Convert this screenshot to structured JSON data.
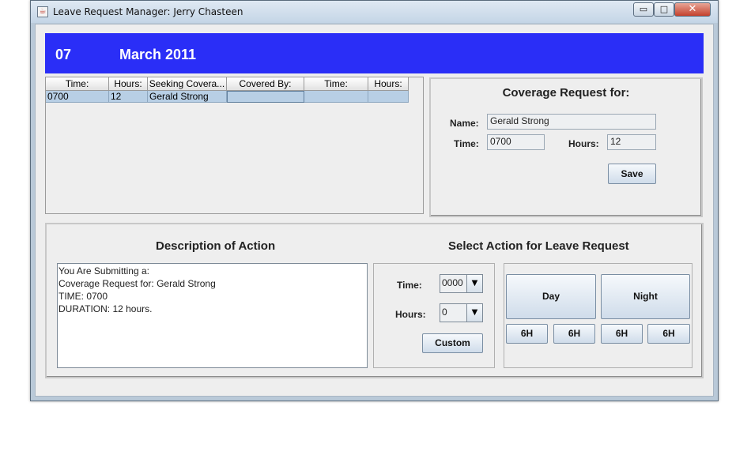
{
  "window": {
    "title": "Leave Request Manager: Jerry Chasteen",
    "controls": {
      "minimize": "▭",
      "maximize": "□",
      "close": "✕"
    }
  },
  "header": {
    "day": "07",
    "month_year": "March 2011",
    "background": "#2a2ef7"
  },
  "table": {
    "columns": [
      "Time:",
      "Hours:",
      "Seeking Covera...",
      "Covered By:",
      "Time:",
      "Hours:"
    ],
    "rows": [
      {
        "time": "0700",
        "hours": "12",
        "seeking": "Gerald Strong",
        "covered_by": "",
        "time2": "",
        "hours2": ""
      }
    ]
  },
  "coverage": {
    "title": "Coverage Request for:",
    "name_label": "Name:",
    "name_value": "Gerald Strong",
    "time_label": "Time:",
    "time_value": "0700",
    "hours_label": "Hours:",
    "hours_value": "12",
    "save_label": "Save"
  },
  "description": {
    "title": "Description of Action",
    "lines": [
      "You Are Submitting a:",
      "Coverage Request for: Gerald Strong",
      "TIME: 0700",
      "DURATION: 12 hours."
    ]
  },
  "action": {
    "title": "Select Action for Leave Request",
    "time_label": "Time:",
    "time_value": "0000",
    "hours_label": "Hours:",
    "hours_value": "0",
    "custom_label": "Custom",
    "day_label": "Day",
    "night_label": "Night",
    "six_h_labels": [
      "6H",
      "6H",
      "6H",
      "6H"
    ]
  }
}
